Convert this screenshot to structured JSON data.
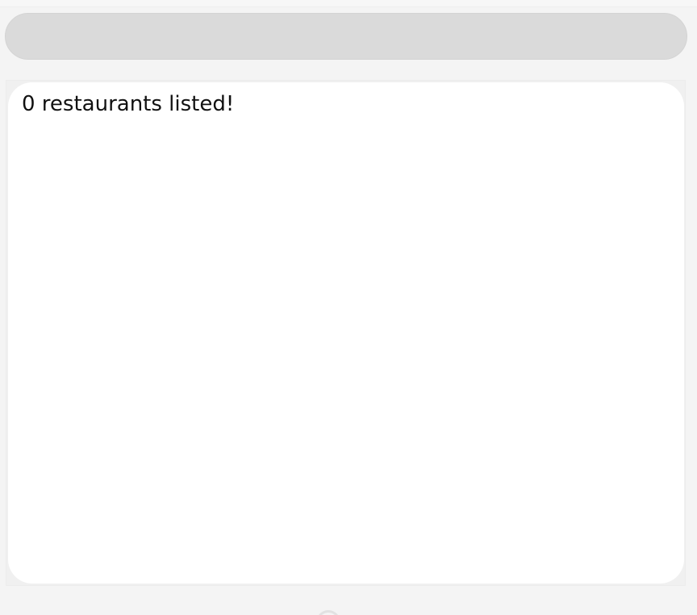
{
  "search": {
    "value": "",
    "placeholder": ""
  },
  "results": {
    "count_text": "0 restaurants listed!"
  },
  "colors": {
    "background": "#f4f4f4",
    "search_fill": "#dadada",
    "panel_fill": "#ffffff",
    "text": "#111111"
  },
  "icons": {
    "bottom": "loading-spinner-icon"
  }
}
